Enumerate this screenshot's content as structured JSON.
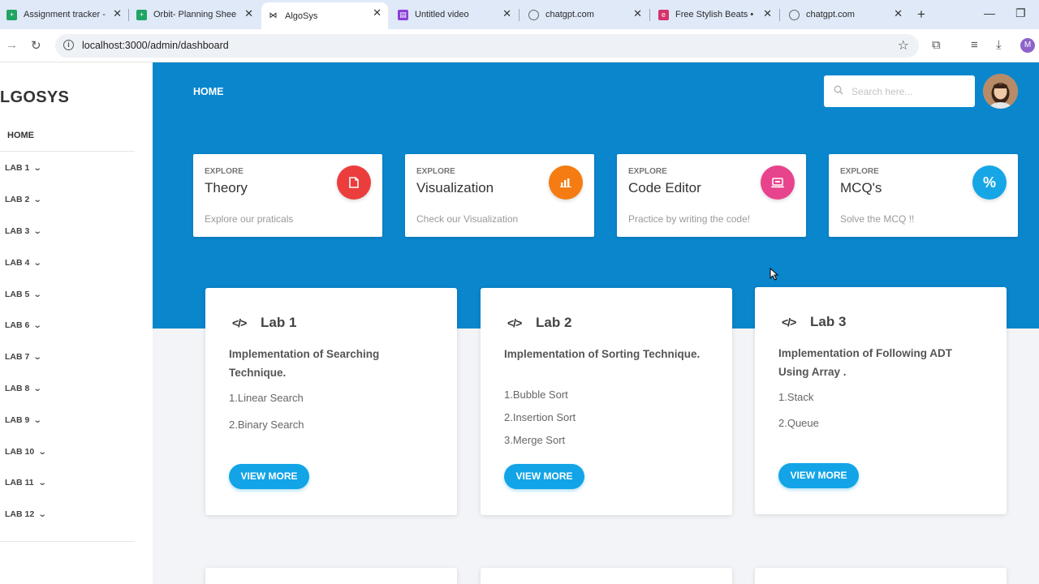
{
  "browser": {
    "tabs": [
      {
        "title": "Assignment tracker -",
        "favicon": "sheets-icon",
        "color": "#1fa463",
        "active": false
      },
      {
        "title": "Orbit- Planning Shee",
        "favicon": "sheets-icon",
        "color": "#1fa463",
        "active": false
      },
      {
        "title": "AlgoSys",
        "favicon": "bowtie-icon",
        "color": "#111111",
        "active": true
      },
      {
        "title": "Untitled video",
        "favicon": "clapper-icon",
        "color": "#8b3fd9",
        "active": false
      },
      {
        "title": "chatgpt.com",
        "favicon": "globe-icon",
        "color": "#666666",
        "active": false
      },
      {
        "title": "Free Stylish Beats • U",
        "favicon": "beats-icon",
        "color": "#d6336c",
        "active": false
      },
      {
        "title": "chatgpt.com",
        "favicon": "globe-icon",
        "color": "#666666",
        "active": false
      }
    ],
    "url": "localhost:3000/admin/dashboard",
    "profile_initial": "M"
  },
  "sidebar": {
    "brand": "LGOSYS",
    "home": "HOME",
    "labs": [
      "LAB 1",
      "LAB 2",
      "LAB 3",
      "LAB 4",
      "LAB 5",
      "LAB 6",
      "LAB 7",
      "LAB 8",
      "LAB 9",
      "LAB 10",
      "LAB 11",
      "LAB 12"
    ]
  },
  "header": {
    "breadcrumb": "HOME",
    "search_placeholder": "Search here...",
    "band_color": "#0a86cd"
  },
  "explore_cards": [
    {
      "pre": "EXPLORE",
      "title": "Theory",
      "desc": "Explore our praticals",
      "icon": "document-icon",
      "color": "#ec3d3d"
    },
    {
      "pre": "EXPLORE",
      "title": "Visualization",
      "desc": "Check our Visualization",
      "icon": "bar-chart-icon",
      "color": "#f57c12"
    },
    {
      "pre": "EXPLORE",
      "title": "Code Editor",
      "desc": "Practice by writing the code!",
      "icon": "laptop-icon",
      "color": "#e8438d"
    },
    {
      "pre": "EXPLORE",
      "title": "MCQ's",
      "desc": "Solve the MCQ !!",
      "icon": "percent-icon",
      "color": "#16a6e6"
    }
  ],
  "lab_cards": [
    {
      "title": "Lab 1",
      "subtitle": "Implementation of Searching Technique.",
      "items": [
        "1.Linear Search",
        "2.Binary Search"
      ],
      "button": "VIEW MORE"
    },
    {
      "title": "Lab 2",
      "subtitle": "Implementation of Sorting Technique.",
      "items": [
        "1.Bubble Sort",
        "2.Insertion Sort",
        "3.Merge Sort"
      ],
      "button": "VIEW MORE"
    },
    {
      "title": "Lab 3",
      "subtitle": "Implementation of Following ADT Using Array .",
      "items": [
        "1.Stack",
        "2.Queue"
      ],
      "button": "VIEW MORE"
    }
  ],
  "code_glyph": "</>"
}
